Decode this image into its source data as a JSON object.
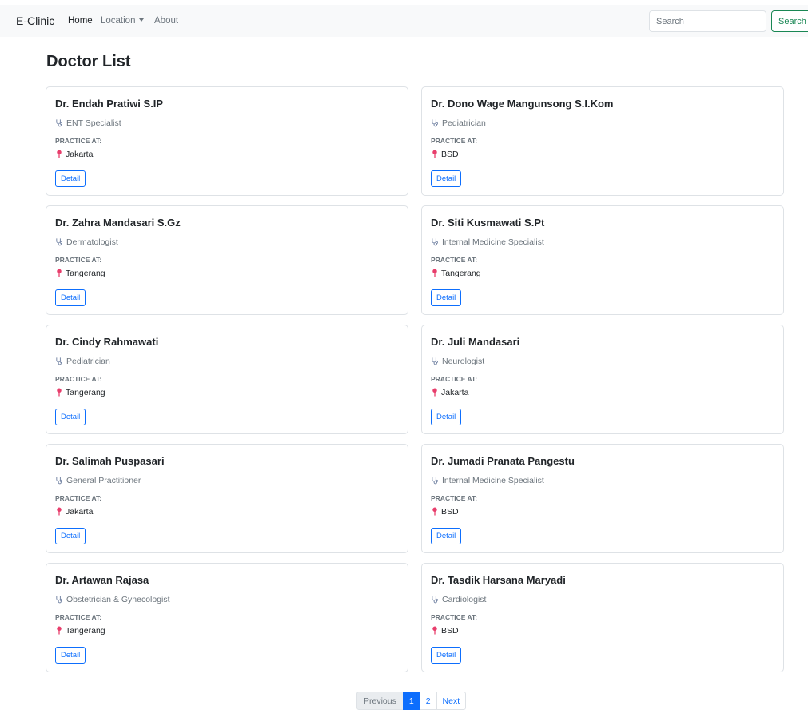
{
  "navbar": {
    "brand": "E-Clinic",
    "links": [
      "Home",
      "Location",
      "About"
    ],
    "search_placeholder": "Search",
    "search_button": "Search"
  },
  "page_title": "Doctor List",
  "practice_label": "PRACTICE AT:",
  "detail_label": "Detail",
  "doctors": [
    {
      "name": "Dr. Endah Pratiwi S.IP",
      "specialty": "ENT Specialist",
      "location": "Jakarta"
    },
    {
      "name": "Dr. Dono Wage Mangunsong S.I.Kom",
      "specialty": "Pediatrician",
      "location": "BSD"
    },
    {
      "name": "Dr. Zahra Mandasari S.Gz",
      "specialty": "Dermatologist",
      "location": "Tangerang"
    },
    {
      "name": "Dr. Siti Kusmawati S.Pt",
      "specialty": "Internal Medicine Specialist",
      "location": "Tangerang"
    },
    {
      "name": "Dr. Cindy Rahmawati",
      "specialty": "Pediatrician",
      "location": "Tangerang"
    },
    {
      "name": "Dr. Juli Mandasari",
      "specialty": "Neurologist",
      "location": "Jakarta"
    },
    {
      "name": "Dr. Salimah Puspasari",
      "specialty": "General Practitioner",
      "location": "Jakarta"
    },
    {
      "name": "Dr. Jumadi Pranata Pangestu",
      "specialty": "Internal Medicine Specialist",
      "location": "BSD"
    },
    {
      "name": "Dr. Artawan Rajasa",
      "specialty": "Obstetrician & Gynecologist",
      "location": "Tangerang"
    },
    {
      "name": "Dr. Tasdik Harsana Maryadi",
      "specialty": "Cardiologist",
      "location": "BSD"
    }
  ],
  "pagination": {
    "previous": "Previous",
    "pages": [
      "1",
      "2"
    ],
    "current": "1",
    "next": "Next"
  },
  "colors": {
    "primary": "#0d6efd",
    "success": "#198754",
    "pin": "#e83e6c",
    "muted": "#6c757d"
  }
}
